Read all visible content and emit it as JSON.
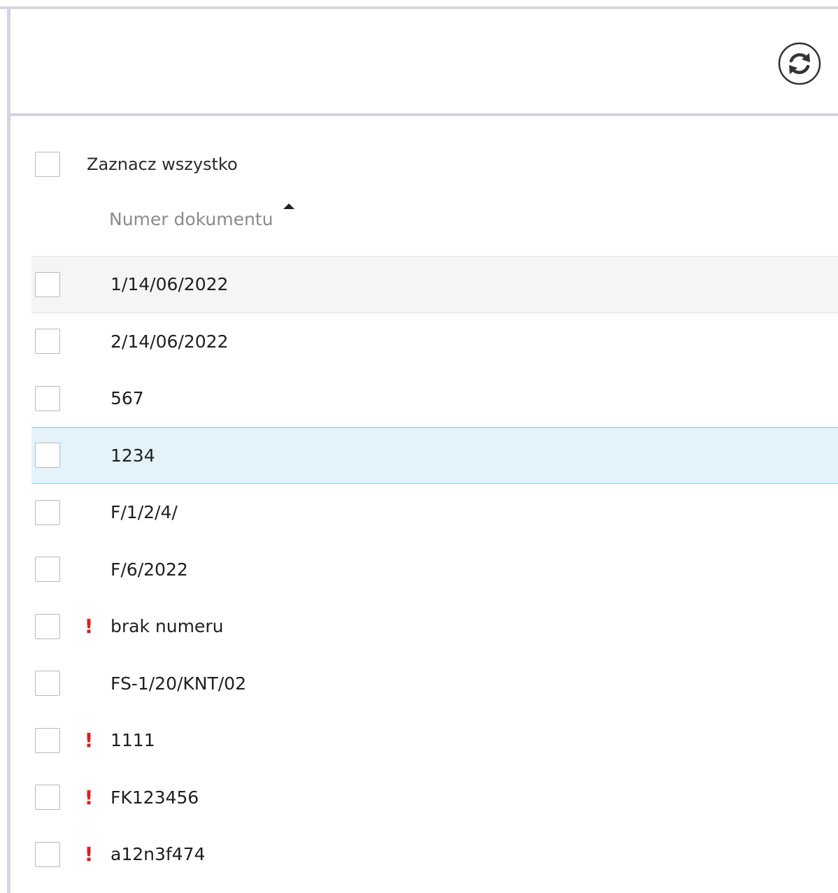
{
  "toolbar": {
    "refresh_icon": "refresh-icon"
  },
  "select_all": {
    "label": "Zaznacz wszystko"
  },
  "table": {
    "column_header": "Numer dokumentu",
    "sort_direction": "ascending",
    "rows": [
      {
        "number": "1/14/06/2022",
        "warning": ""
      },
      {
        "number": "2/14/06/2022",
        "warning": ""
      },
      {
        "number": "567",
        "warning": ""
      },
      {
        "number": "1234",
        "warning": ""
      },
      {
        "number": "F/1/2/4/",
        "warning": ""
      },
      {
        "number": "F/6/2022",
        "warning": ""
      },
      {
        "number": "brak numeru",
        "warning": "!"
      },
      {
        "number": "FS-1/20/KNT/02",
        "warning": ""
      },
      {
        "number": "1111",
        "warning": "!"
      },
      {
        "number": "FK123456",
        "warning": "!"
      },
      {
        "number": "a12n3f474",
        "warning": "!"
      }
    ]
  },
  "colors": {
    "warning": "#e31b1b",
    "hover_row_bg": "#e4f2fa",
    "hover_row_border": "#8ccae8",
    "divider": "#d3d4e0"
  }
}
